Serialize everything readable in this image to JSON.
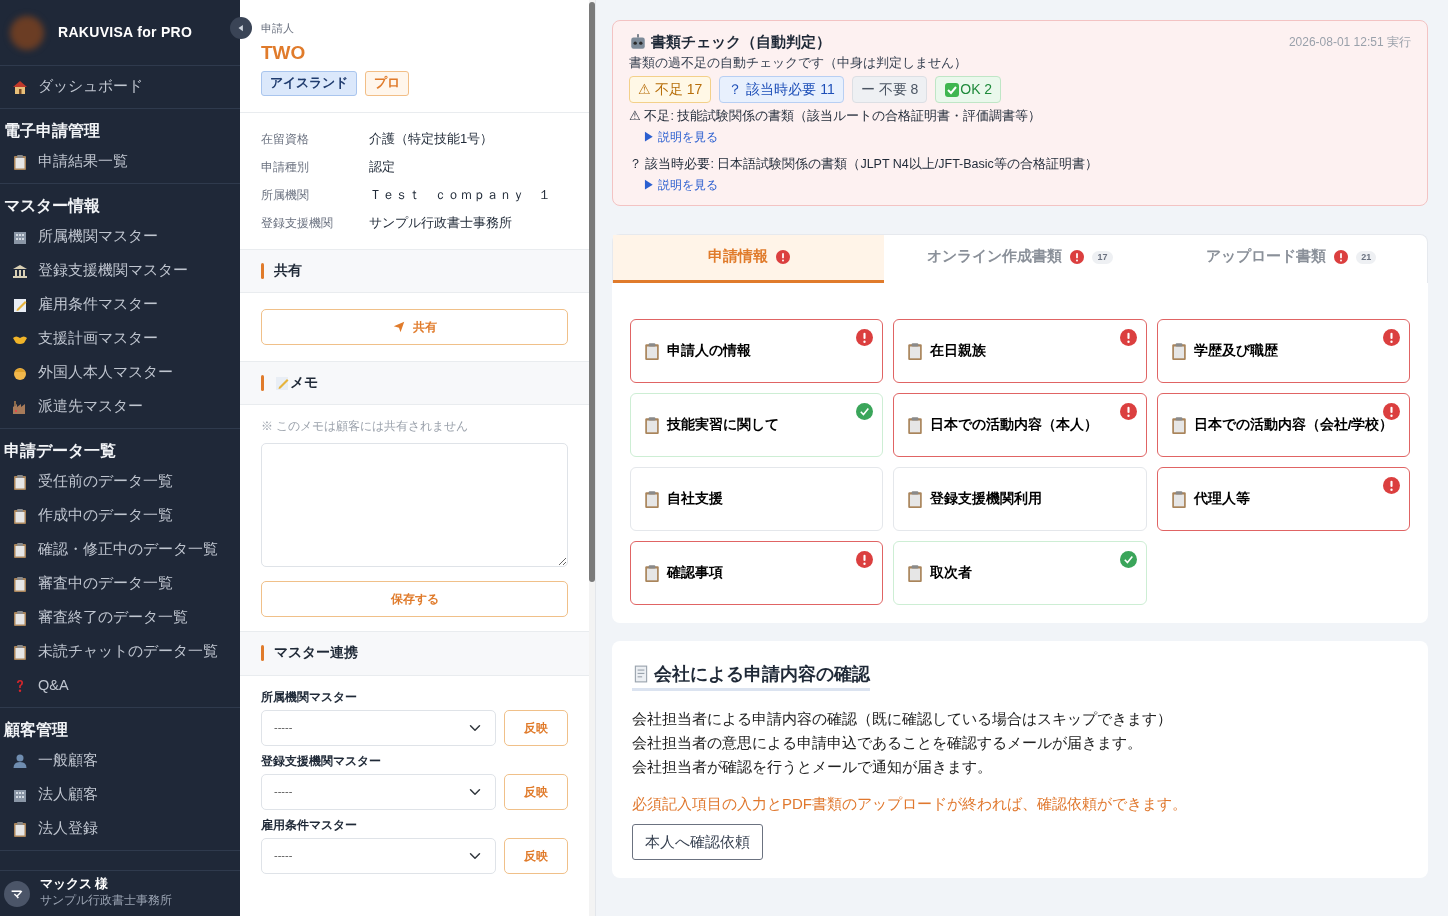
{
  "sidebar": {
    "brand": "RAKUVISA for PRO",
    "sections": [
      {
        "items": [
          {
            "label": "ダッシュボード"
          }
        ]
      },
      {
        "heading": "電子申請管理",
        "items": [
          {
            "label": "申請結果一覧"
          }
        ]
      },
      {
        "heading": "マスター情報",
        "items": [
          {
            "label": "所属機関マスター"
          },
          {
            "label": "登録支援機関マスター"
          },
          {
            "label": "雇用条件マスター"
          },
          {
            "label": "支援計画マスター"
          },
          {
            "label": "外国人本人マスター"
          },
          {
            "label": "派遣先マスター"
          }
        ]
      },
      {
        "heading": "申請データ一覧",
        "items": [
          {
            "label": "受任前のデータ一覧"
          },
          {
            "label": "作成中のデータ一覧"
          },
          {
            "label": "確認・修正中のデータ一覧"
          },
          {
            "label": "審査中のデータ一覧"
          },
          {
            "label": "審査終了のデータ一覧"
          },
          {
            "label": "未読チャットのデータ一覧"
          },
          {
            "label": "Q&A"
          }
        ]
      },
      {
        "heading": "顧客管理",
        "items": [
          {
            "label": "一般顧客"
          },
          {
            "label": "法人顧客"
          },
          {
            "label": "法人登録"
          }
        ]
      }
    ],
    "user": {
      "initial": "マ",
      "name": "マックス 様",
      "org": "サンプル行政書士事務所"
    }
  },
  "applicant": {
    "label": "申請人",
    "name": "TWO",
    "tags": [
      {
        "text": "アイスランド",
        "kind": "country"
      },
      {
        "text": "プロ",
        "kind": "plan"
      }
    ],
    "fields": [
      {
        "label": "在留資格",
        "value": "介護（特定技能1号）"
      },
      {
        "label": "申請種別",
        "value": "認定"
      },
      {
        "label": "所属機関",
        "value": "Ｔｅｓｔ　ｃｏｍｐａｎｙ　１"
      },
      {
        "label": "登録支援機関",
        "value": "サンプル行政書士事務所"
      }
    ]
  },
  "share": {
    "heading": "共有",
    "button": "共有"
  },
  "memo": {
    "heading": "メモ",
    "note": "※ このメモは顧客には共有されません",
    "save_button": "保存する"
  },
  "master_link": {
    "heading": "マスター連携",
    "rows": [
      {
        "label": "所属機関マスター",
        "value": "-----",
        "button": "反映"
      },
      {
        "label": "登録支援機関マスター",
        "value": "-----",
        "button": "反映"
      },
      {
        "label": "雇用条件マスター",
        "value": "-----",
        "button": "反映"
      }
    ]
  },
  "doc_check": {
    "title": "書類チェック（自動判定）",
    "timestamp": "2026-08-01 12:51 実行",
    "subtitle": "書類の過不足の自動チェックです（中身は判定しません）",
    "chips": [
      {
        "kind": "missing",
        "symbol": "⚠",
        "text": "不足 17"
      },
      {
        "kind": "conditional",
        "symbol": "？",
        "text": "該当時必要 11"
      },
      {
        "kind": "unneeded",
        "symbol": "ー",
        "text": "不要 8"
      },
      {
        "kind": "ok",
        "text": "OK 2"
      }
    ],
    "notes": [
      {
        "text": "⚠ 不足: 技能試験関係の書類（該当ルートの合格証明書・評価調書等）",
        "link": "▶ 説明を見る"
      },
      {
        "text": "？ 該当時必要: 日本語試験関係の書類（JLPT N4以上/JFT-Basic等の合格証明書）",
        "link": "▶ 説明を見る"
      }
    ]
  },
  "tabs": [
    {
      "label": "申請情報",
      "selected": true,
      "alert": true
    },
    {
      "label": "オンライン作成書類",
      "selected": false,
      "alert": true,
      "count": "17"
    },
    {
      "label": "アップロード書類",
      "selected": false,
      "alert": true,
      "count": "21"
    }
  ],
  "sections": [
    {
      "title": "申請人の情報",
      "error": true,
      "complete": false
    },
    {
      "title": "在日親族",
      "error": true,
      "complete": false
    },
    {
      "title": "学歴及び職歴",
      "error": true,
      "complete": false
    },
    {
      "title": "技能実習に関して",
      "error": false,
      "complete": true
    },
    {
      "title": "日本での活動内容（本人）",
      "error": true,
      "complete": false
    },
    {
      "title": "日本での活動内容（会社/学校）",
      "error": true,
      "complete": false
    },
    {
      "title": "自社支援",
      "error": false,
      "complete": false
    },
    {
      "title": "登録支援機関利用",
      "error": false,
      "complete": false
    },
    {
      "title": "代理人等",
      "error": true,
      "complete": false
    },
    {
      "title": "確認事項",
      "error": true,
      "complete": false
    },
    {
      "title": "取次者",
      "error": false,
      "complete": true
    }
  ],
  "company_confirm": {
    "title": "会社による申請内容の確認",
    "lines": [
      "会社担当者による申請内容の確認（既に確認している場合はスキップできます）",
      "会社担当者の意思による申請申込であることを確認するメールが届きます。",
      "会社担当者が確認を行うとメールで通知が届きます。"
    ],
    "warning": "必須記入項目の入力とPDF書類のアップロードが終われば、確認依頼ができます。",
    "button": "本人へ確認依頼"
  }
}
